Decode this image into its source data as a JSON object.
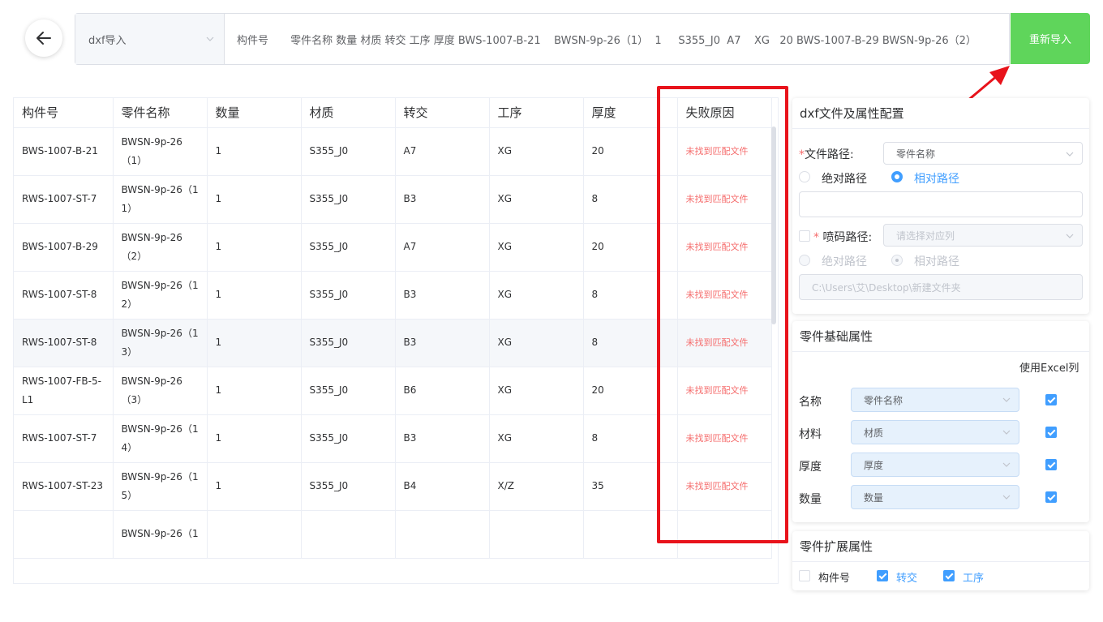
{
  "topbar": {
    "import_type": "dxf导入",
    "paste_text": "构件号\t零件名称 数量 材质 转交 工序 厚度 BWS-1007-B-21    BWSN-9p-26（1）  1     S355_J0  A7    XG   20 BWS-1007-B-29 BWSN-9p-26（2）",
    "reimport_label": "重新导入"
  },
  "table": {
    "headers": [
      "构件号",
      "零件名称",
      "数量",
      "材质",
      "转交",
      "工序",
      "厚度",
      "失败原因"
    ],
    "rows": [
      [
        "BWS-1007-B-21",
        "BWSN-9p-26（1）",
        "1",
        "S355_J0",
        "A7",
        "XG",
        "20",
        "未找到匹配文件"
      ],
      [
        "RWS-1007-ST-7",
        "BWSN-9p-26（11）",
        "1",
        "S355_J0",
        "B3",
        "XG",
        "8",
        "未找到匹配文件"
      ],
      [
        "BWS-1007-B-29",
        "BWSN-9p-26（2）",
        "1",
        "S355_J0",
        "A7",
        "XG",
        "20",
        "未找到匹配文件"
      ],
      [
        "RWS-1007-ST-8",
        "BWSN-9p-26（12）",
        "1",
        "S355_J0",
        "B3",
        "XG",
        "8",
        "未找到匹配文件"
      ],
      [
        "RWS-1007-ST-8",
        "BWSN-9p-26（13）",
        "1",
        "S355_J0",
        "B3",
        "XG",
        "8",
        "未找到匹配文件"
      ],
      [
        "RWS-1007-FB-5-L1",
        "BWSN-9p-26（3）",
        "1",
        "S355_J0",
        "B6",
        "XG",
        "20",
        "未找到匹配文件"
      ],
      [
        "RWS-1007-ST-7",
        "BWSN-9p-26（14）",
        "1",
        "S355_J0",
        "B3",
        "XG",
        "8",
        "未找到匹配文件"
      ],
      [
        "RWS-1007-ST-23",
        "BWSN-9p-26（15）",
        "1",
        "S355_J0",
        "B4",
        "X/Z",
        "35",
        "未找到匹配文件"
      ],
      [
        "",
        "BWSN-9p-26（1",
        "",
        "",
        "",
        "",
        "",
        ""
      ]
    ]
  },
  "config": {
    "title": "dxf文件及属性配置",
    "file_path_required": "*",
    "file_path_label": "文件路径:",
    "file_path_value": "零件名称",
    "absolute_label": "绝对路径",
    "relative_label": "相对路径",
    "spray_required": "*",
    "spray_label": "喷码路径:",
    "spray_placeholder": "请选择对应列",
    "spray_absolute_label": "绝对路径",
    "spray_relative_label": "相对路径",
    "spray_dir": "C:\\Users\\艾\\Desktop\\新建文件夹"
  },
  "basic": {
    "title": "零件基础属性",
    "use_excel_label": "使用Excel列",
    "rows": [
      {
        "label": "名称",
        "value": "零件名称"
      },
      {
        "label": "材料",
        "value": "材质"
      },
      {
        "label": "厚度",
        "value": "厚度"
      },
      {
        "label": "数量",
        "value": "数量"
      }
    ]
  },
  "extended": {
    "title": "零件扩展属性",
    "items": [
      {
        "label": "构件号",
        "checked": false
      },
      {
        "label": "转交",
        "checked": true
      },
      {
        "label": "工序",
        "checked": true
      }
    ]
  },
  "colors": {
    "accent": "#409eff",
    "success": "#5fd55b",
    "error": "#f56c6c",
    "annotation": "#e8131b"
  }
}
